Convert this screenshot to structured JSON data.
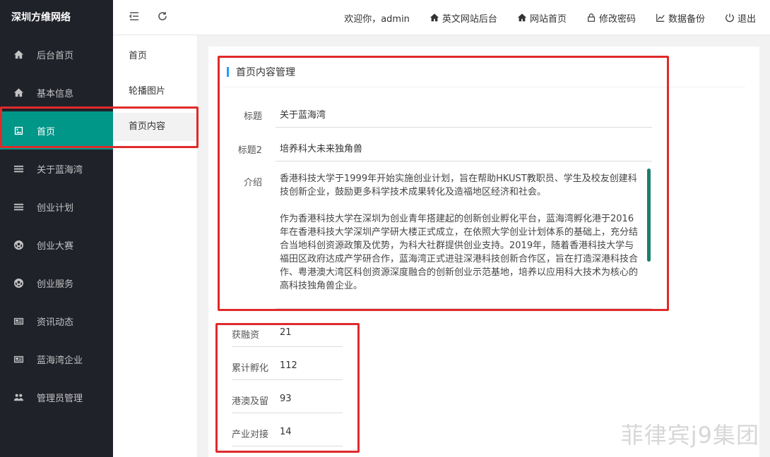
{
  "brand": "深圳方维网络",
  "sidebar": {
    "items": [
      {
        "label": "后台首页",
        "icon": "home-icon"
      },
      {
        "label": "基本信息",
        "icon": "home-icon"
      },
      {
        "label": "首页",
        "icon": "picture-icon",
        "active": true
      },
      {
        "label": "关于蓝海湾",
        "icon": "list-icon"
      },
      {
        "label": "创业计划",
        "icon": "list-icon"
      },
      {
        "label": "创业大赛",
        "icon": "soccer-ball-icon"
      },
      {
        "label": "创业服务",
        "icon": "soccer-ball-icon"
      },
      {
        "label": "资讯动态",
        "icon": "newspaper-icon"
      },
      {
        "label": "蓝海湾企业",
        "icon": "newspaper-icon"
      },
      {
        "label": "管理员管理",
        "icon": "users-icon"
      }
    ]
  },
  "header": {
    "welcome": "欢迎你，admin",
    "links": [
      {
        "label": "英文网站后台",
        "icon": "home-icon"
      },
      {
        "label": "网站首页",
        "icon": "home-icon"
      },
      {
        "label": "修改密码",
        "icon": "lock-icon"
      },
      {
        "label": "数据备份",
        "icon": "chart-icon"
      },
      {
        "label": "退出",
        "icon": "power-icon"
      }
    ]
  },
  "subnav": {
    "items": [
      "首页",
      "轮播图片",
      "首页内容"
    ]
  },
  "main": {
    "section_title": "首页内容管理",
    "fields": [
      {
        "label": "标题",
        "value": "关于蓝海湾"
      },
      {
        "label": "标题2",
        "value": "培养科大未来独角兽"
      }
    ],
    "intro_label": "介绍",
    "intro_paragraphs": [
      "香港科技大学于1999年开始实施创业计划，旨在帮助HKUST教职员、学生及校友创建科技创新企业，鼓励更多科学技术成果转化及造福地区经济和社会。",
      "作为香港科技大学在深圳为创业青年搭建起的创新创业孵化平台，蓝海湾孵化港于2016年在香港科技大学深圳产学研大楼正式成立，在依照大学创业计划体系的基础上，充分结合当地科创资源政策及优势，为科大社群提供创业支持。2019年，随着香港科技大学与福田区政府达成产学研合作，蓝海湾正式进驻深港科技创新合作区，旨在打造深港科技合作、粤港澳大湾区科创资源深度融合的创新创业示范基地，培养以应用科大技术为核心的高科技独角兽企业。"
    ],
    "stats": [
      {
        "label": "获融资",
        "value": "21"
      },
      {
        "label": "累计孵化",
        "value": "112"
      },
      {
        "label": "港澳及留",
        "value": "93"
      },
      {
        "label": "产业对接",
        "value": "14"
      }
    ]
  },
  "watermark": "菲律宾j9集团",
  "colors": {
    "sidebar_bg": "#20222a",
    "active": "#009688",
    "annotation": "#e02a2a",
    "title_bar": "#1E9FFF"
  }
}
